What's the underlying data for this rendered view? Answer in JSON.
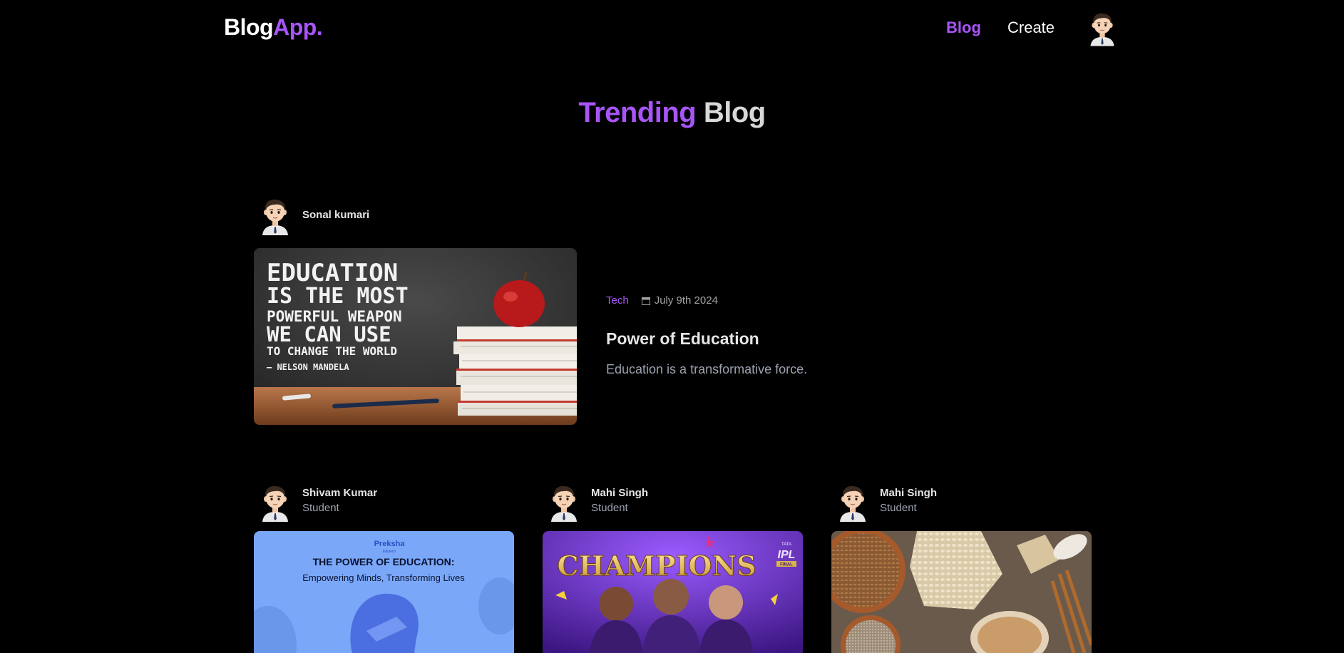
{
  "nav": {
    "logo_main": "Blog",
    "logo_accent": "App.",
    "links": [
      {
        "label": "Blog",
        "active": true
      },
      {
        "label": "Create",
        "active": false
      }
    ]
  },
  "page_heading": {
    "accent": "Trending",
    "rest": " Blog"
  },
  "featured": {
    "author": {
      "name": "Sonal kumari"
    },
    "image_text": {
      "line1": "EDUCATION",
      "line2": "IS THE MOST",
      "line3": "POWERFUL WEAPON",
      "line4": "WE CAN USE",
      "line5": "TO CHANGE THE WORLD",
      "line6": "– NELSON MANDELA"
    },
    "category": "Tech",
    "date": "July 9th 2024",
    "title": "Power of Education",
    "description": "Education is a transformative force."
  },
  "cards": [
    {
      "author": {
        "name": "Shivam Kumar",
        "role": "Student"
      },
      "image_text": {
        "brand": "Preksha",
        "brand_sub": "Edutech",
        "headline": "THE POWER OF EDUCATION:",
        "subline": "Empowering Minds, Transforming Lives"
      }
    },
    {
      "author": {
        "name": "Mahi Singh",
        "role": "Student"
      },
      "image_text": {
        "headline": "CHAMPIONS",
        "badge_top": "TATA",
        "badge_main": "IPL",
        "badge_bottom": "FINAL"
      }
    },
    {
      "author": {
        "name": "Mahi Singh",
        "role": "Student"
      }
    }
  ],
  "colors": {
    "accent": "#a855f7",
    "background": "#000000",
    "muted": "#9ca3af"
  }
}
